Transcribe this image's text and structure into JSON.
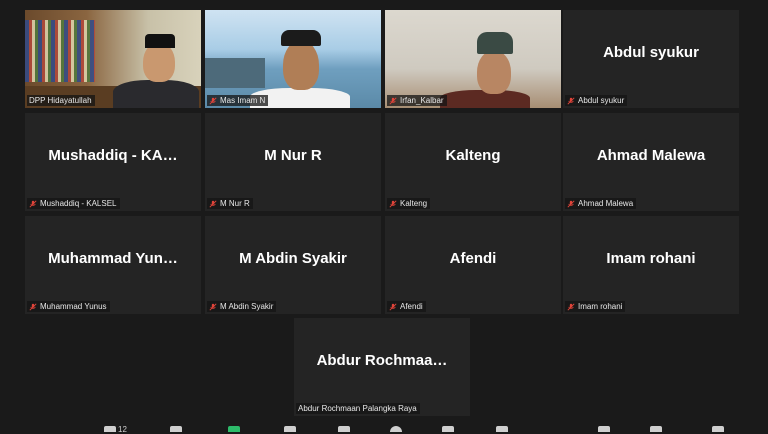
{
  "participants": [
    {
      "label": "DPP Hidayatullah",
      "big": "",
      "video": "v1",
      "active": true
    },
    {
      "label": "Mas Imam N",
      "big": "",
      "video": "v2",
      "active": false
    },
    {
      "label": "Irfan_Kalbar",
      "big": "",
      "video": "v3",
      "active": false
    },
    {
      "label": "Abdul syukur",
      "big": "Abdul syukur",
      "video": "",
      "active": false
    },
    {
      "label": "Mushaddiq - KALSEL",
      "big": "Mushaddiq  -  KA…",
      "video": "",
      "active": false
    },
    {
      "label": "M Nur R",
      "big": "M Nur R",
      "video": "",
      "active": false
    },
    {
      "label": "Kalteng",
      "big": "Kalteng",
      "video": "",
      "active": false
    },
    {
      "label": "Ahmad Malewa",
      "big": "Ahmad Malewa",
      "video": "",
      "active": false
    },
    {
      "label": "Muhammad Yunus",
      "big": "Muhammad  Yun…",
      "video": "",
      "active": false
    },
    {
      "label": "M Abdin Syakir",
      "big": "M Abdin Syakir",
      "video": "",
      "active": false
    },
    {
      "label": "Afendi",
      "big": "Afendi",
      "video": "",
      "active": false
    },
    {
      "label": "Imam rohani",
      "big": "Imam rohani",
      "video": "",
      "active": false
    },
    {
      "label": "Abdur Rochmaan Palangka Raya",
      "big": "Abdur  Rochmaa…",
      "video": "",
      "active": false
    }
  ],
  "toolbar": {
    "participants_count": "12",
    "icons": [
      "participants-icon",
      "chat-icon",
      "share-screen-icon",
      "record-icon",
      "reactions-icon",
      "apps-icon",
      "whiteboard-icon",
      "notes-icon",
      "more-icon",
      "end-icon"
    ]
  },
  "colors": {
    "background": "#1a1a1a",
    "tile": "#242424",
    "active_border": "#d6e04a",
    "muted_mic": "#e0443a"
  }
}
